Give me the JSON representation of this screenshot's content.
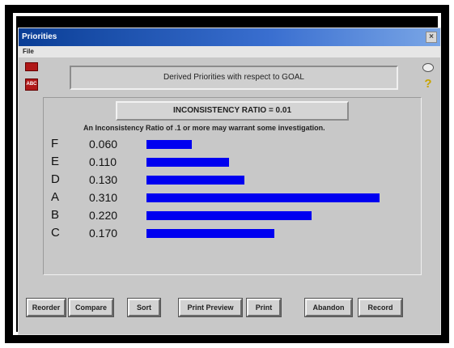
{
  "window": {
    "title": "Priorities",
    "close_glyph": "×",
    "menu": [
      "File"
    ]
  },
  "icons": {
    "abc_label": "ABC"
  },
  "header": {
    "text": "Derived Priorities with respect to GOAL"
  },
  "inconsistency": {
    "ratio_text": "INCONSISTENCY RATIO = 0.01",
    "warning": "An Inconsistency Ratio of .1 or more may warrant some investigation."
  },
  "chart_data": {
    "type": "bar",
    "orientation": "horizontal",
    "categories": [
      "F",
      "E",
      "D",
      "A",
      "B",
      "C"
    ],
    "values": [
      0.06,
      0.11,
      0.13,
      0.31,
      0.22,
      0.17
    ],
    "value_labels": [
      "0.060",
      "0.110",
      "0.130",
      "0.310",
      "0.220",
      "0.170"
    ],
    "bar_color": "#0000f0"
  },
  "buttons": [
    "Reorder",
    "Compare",
    "Sort",
    "Print Preview",
    "Print",
    "Abandon",
    "Record"
  ]
}
